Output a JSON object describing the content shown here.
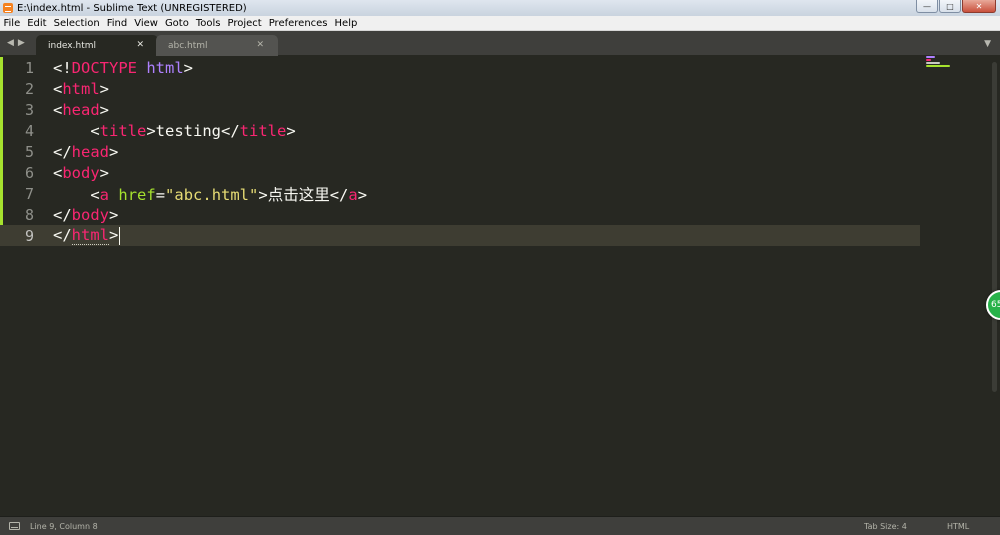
{
  "window": {
    "title": "E:\\index.html - Sublime Text (UNREGISTERED)",
    "controls": {
      "minimize": "—",
      "maximize": "□",
      "close": "✕"
    }
  },
  "menu": [
    "File",
    "Edit",
    "Selection",
    "Find",
    "View",
    "Goto",
    "Tools",
    "Project",
    "Preferences",
    "Help"
  ],
  "tabs": {
    "nav_back": "◀",
    "nav_forward": "▶",
    "items": [
      {
        "label": "index.html",
        "close": "✕",
        "active": true
      },
      {
        "label": "abc.html",
        "close": "✕",
        "active": false
      }
    ],
    "dropdown": "▼"
  },
  "editor": {
    "lines": [
      {
        "num": "1",
        "parts": [
          [
            "<!",
            "pl"
          ],
          [
            "DOCTYPE",
            "tag"
          ],
          [
            " ",
            "pl"
          ],
          [
            "html",
            "doc"
          ],
          [
            ">",
            "pl"
          ]
        ]
      },
      {
        "num": "2",
        "parts": [
          [
            "<",
            "pl"
          ],
          [
            "html",
            "tag"
          ],
          [
            ">",
            "pl"
          ]
        ]
      },
      {
        "num": "3",
        "parts": [
          [
            "<",
            "pl"
          ],
          [
            "head",
            "tag"
          ],
          [
            ">",
            "pl"
          ]
        ]
      },
      {
        "num": "4",
        "parts": [
          [
            "    <",
            "pl"
          ],
          [
            "title",
            "tag"
          ],
          [
            ">testing</",
            "pl"
          ],
          [
            "title",
            "tag"
          ],
          [
            ">",
            "pl"
          ]
        ]
      },
      {
        "num": "5",
        "parts": [
          [
            "</",
            "pl"
          ],
          [
            "head",
            "tag"
          ],
          [
            ">",
            "pl"
          ]
        ]
      },
      {
        "num": "6",
        "parts": [
          [
            "<",
            "pl"
          ],
          [
            "body",
            "tag"
          ],
          [
            ">",
            "pl"
          ]
        ]
      },
      {
        "num": "7",
        "parts": [
          [
            "    <",
            "pl"
          ],
          [
            "a",
            "tag"
          ],
          [
            " ",
            "pl"
          ],
          [
            "href",
            "attr"
          ],
          [
            "=",
            "pl"
          ],
          [
            "\"abc.html\"",
            "str"
          ],
          [
            ">点击这里</",
            "pl"
          ],
          [
            "a",
            "tag"
          ],
          [
            ">",
            "pl"
          ]
        ]
      },
      {
        "num": "8",
        "parts": [
          [
            "</",
            "pl"
          ],
          [
            "body",
            "tag"
          ],
          [
            ">",
            "pl"
          ]
        ]
      },
      {
        "num": "9",
        "parts": [
          [
            "</",
            "pl"
          ],
          [
            "html",
            "tag"
          ],
          [
            ">",
            "pl"
          ]
        ],
        "current": true
      }
    ]
  },
  "badge": {
    "text": "65"
  },
  "status": {
    "position": "Line 9, Column 8",
    "tab_size": "Tab Size: 4",
    "syntax": "HTML"
  },
  "colors": {
    "background": "#272822",
    "tag": "#f92672",
    "attribute": "#a6e22e",
    "string": "#e6db74",
    "doctype_keyword": "#ae81ff",
    "text": "#f8f8f2",
    "line_number": "#8f908a",
    "current_line": "#3e3d32"
  }
}
